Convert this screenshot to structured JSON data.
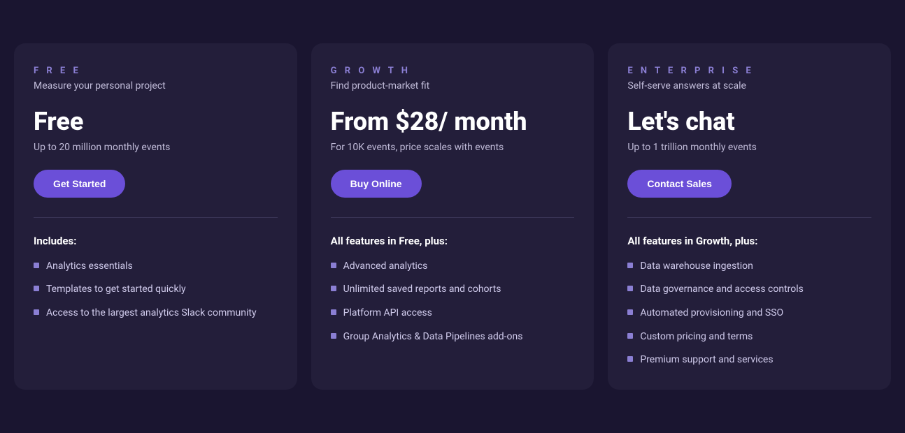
{
  "cards": [
    {
      "id": "free",
      "label": "F R E E",
      "tagline": "Measure your personal project",
      "price": "Free",
      "price_note": "Up to 20 million monthly events",
      "button_label": "Get Started",
      "features_heading": "Includes:",
      "features": [
        "Analytics essentials",
        "Templates to get started quickly",
        "Access to the largest analytics Slack community"
      ]
    },
    {
      "id": "growth",
      "label": "G R O W T H",
      "tagline": "Find product-market fit",
      "price": "From $28/ month",
      "price_note": "For 10K events, price scales with events",
      "button_label": "Buy Online",
      "features_heading": "All features in Free, plus:",
      "features": [
        "Advanced analytics",
        "Unlimited saved reports and cohorts",
        "Platform API access",
        "Group Analytics & Data Pipelines add-ons"
      ]
    },
    {
      "id": "enterprise",
      "label": "E N T E R P R I S E",
      "tagline": "Self-serve answers at scale",
      "price": "Let's chat",
      "price_note": "Up to 1 trillion monthly events",
      "button_label": "Contact Sales",
      "features_heading": "All features in Growth, plus:",
      "features": [
        "Data warehouse ingestion",
        "Data governance and access controls",
        "Automated provisioning and SSO",
        "Custom pricing and terms",
        "Premium support and services"
      ]
    }
  ]
}
